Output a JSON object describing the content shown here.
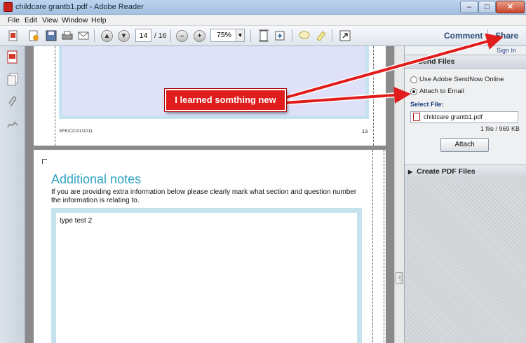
{
  "window": {
    "title": "childcare grantb1.pdf - Adobe Reader",
    "min_glyph": "–",
    "max_glyph": "□",
    "close_glyph": "✕"
  },
  "menu": [
    "File",
    "Edit",
    "View",
    "Window",
    "Help"
  ],
  "toolbar": {
    "page_current": "14",
    "page_total": "/ 16",
    "zoom": "75%",
    "comment": "Comment",
    "share": "Share",
    "minus": "–",
    "plus": "+",
    "zoom_arrow": "▼",
    "prev_glyph": "▲",
    "next_glyph": "▼"
  },
  "doc": {
    "page1": {
      "footer_code": "SFE/CCG1/1011",
      "page_number": "13"
    },
    "page2": {
      "heading": "Additional notes",
      "instructions": "If you are providing extra information below please clearly mark what section and question number the information is relating to.",
      "field_text": "type test 2"
    }
  },
  "panel": {
    "sign_in": "Sign In",
    "section1": "Send Files",
    "section1_arrow": "▼",
    "option1": "Use Adobe SendNow Online",
    "option2": "Attach to Email",
    "select_label": "Select File:",
    "file_name": "childcare grantb1.pdf",
    "file_info": "1 file / 969 KB",
    "attach_button": "Attach",
    "section2": "Create PDF Files",
    "section2_arrow": "▶"
  },
  "annotation": {
    "callout": "I learned somthing new",
    "color": "#e11c1c"
  },
  "colors": {
    "accent_link": "#2a4a7a",
    "heading_teal": "#2ea3c4",
    "box_border": "#c5e2ee"
  }
}
